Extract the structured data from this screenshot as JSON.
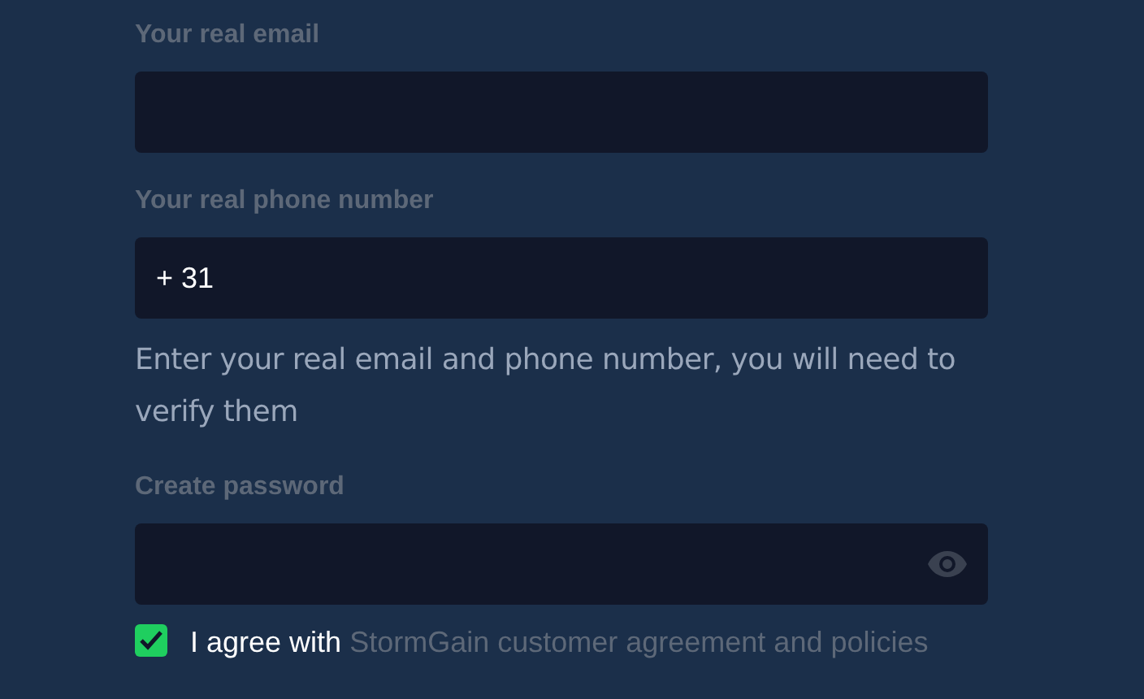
{
  "fields": [
    {
      "kind": "text",
      "label": "Your real email"
    },
    {
      "kind": "phone",
      "label": "Your real phone number",
      "value": "+ 31"
    },
    {
      "kind": "password",
      "label": "Create password"
    }
  ],
  "helper": "Enter your real email and phone number, you will need to verify them",
  "agreement": {
    "checked": true,
    "text": "I agree with",
    "link": "StormGain customer agreement and policies"
  }
}
